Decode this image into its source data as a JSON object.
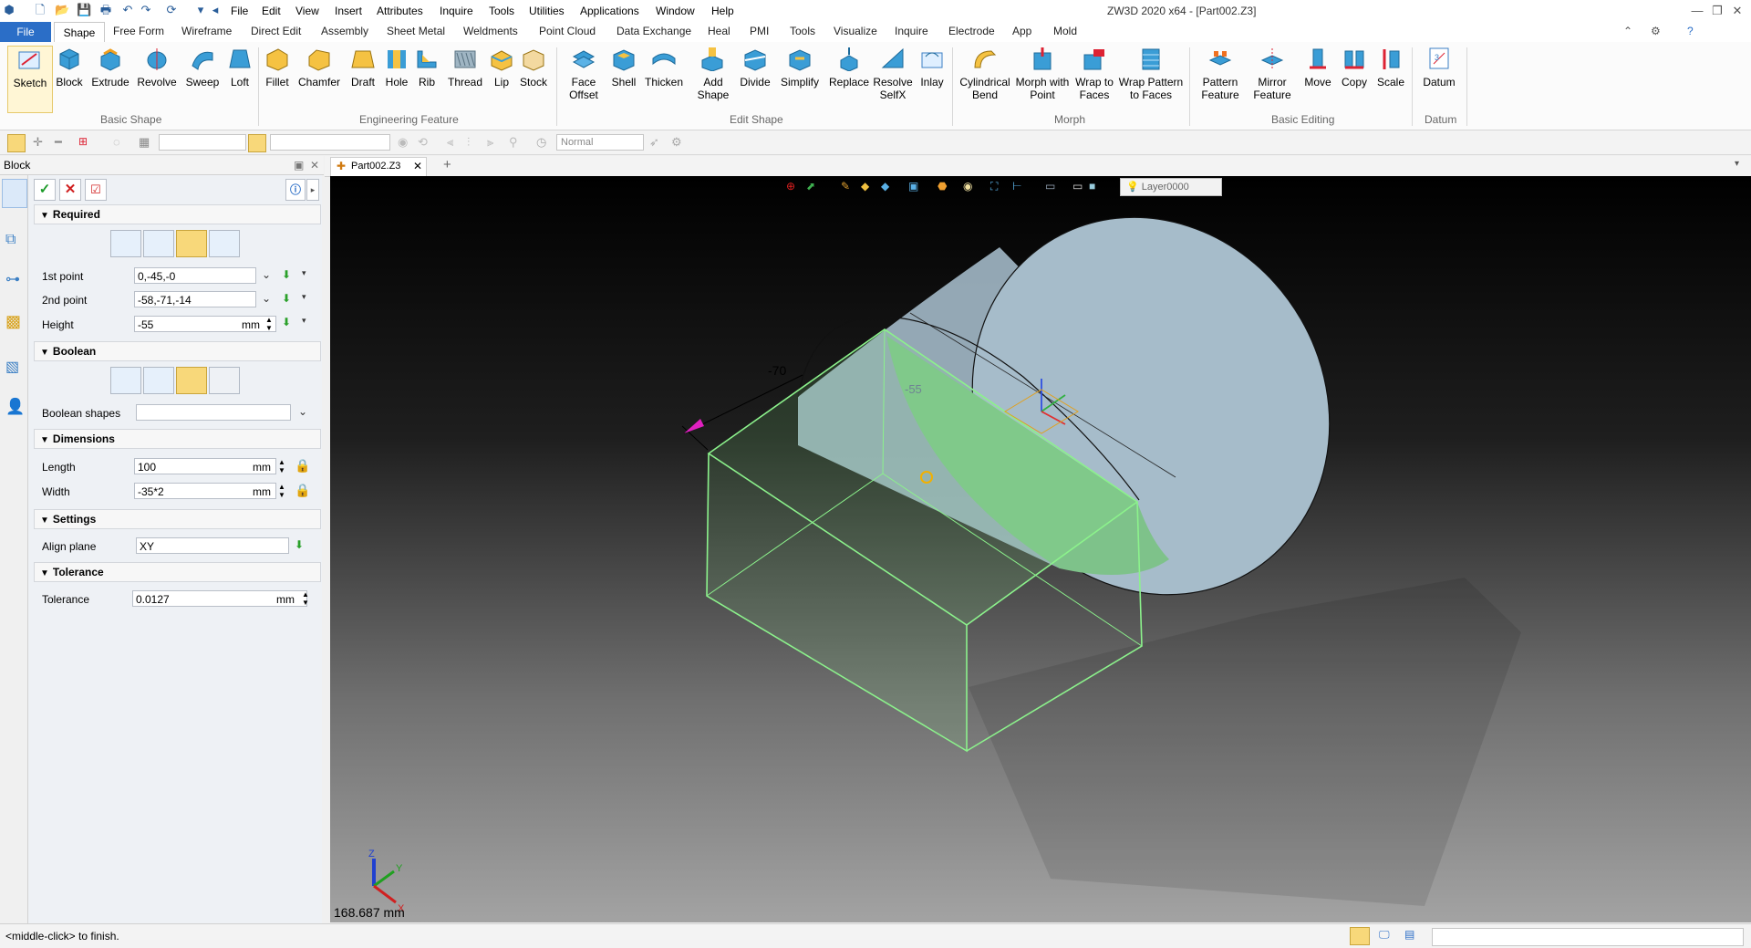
{
  "window": {
    "title": "ZW3D 2020 x64 - [Part002.Z3]",
    "menus": [
      "File",
      "Edit",
      "View",
      "Insert",
      "Attributes",
      "Inquire",
      "Tools",
      "Utilities",
      "Applications",
      "Window",
      "Help"
    ]
  },
  "ribbon": {
    "file_tab": "File",
    "tabs": [
      "Shape",
      "Free Form",
      "Wireframe",
      "Direct Edit",
      "Assembly",
      "Sheet Metal",
      "Weldments",
      "Point Cloud",
      "Data Exchange",
      "Heal",
      "PMI",
      "Tools",
      "Visualize",
      "Inquire",
      "Electrode",
      "App",
      "Mold"
    ],
    "active_tab": "Shape",
    "groups": [
      {
        "label": "Basic Shape",
        "buttons": [
          "Sketch",
          "Block",
          "Extrude",
          "Revolve",
          "Sweep",
          "Loft"
        ]
      },
      {
        "label": "Engineering Feature",
        "buttons": [
          "Fillet",
          "Chamfer",
          "Draft",
          "Hole",
          "Rib",
          "Thread",
          "Lip",
          "Stock"
        ]
      },
      {
        "label": "Edit Shape",
        "buttons": [
          "Face Offset",
          "Shell",
          "Thicken",
          "Add Shape",
          "Divide",
          "Simplify",
          "Replace",
          "Resolve SelfX",
          "Inlay"
        ]
      },
      {
        "label": "Morph",
        "buttons": [
          "Cylindrical Bend",
          "Morph with Point",
          "Wrap to Faces",
          "Wrap Pattern to Faces"
        ]
      },
      {
        "label": "Basic Editing",
        "buttons": [
          "Pattern Feature",
          "Mirror Feature",
          "Move",
          "Copy",
          "Scale"
        ]
      },
      {
        "label": "Datum",
        "buttons": [
          "Datum"
        ]
      }
    ]
  },
  "toolbar2": {
    "style_combo": "Normal"
  },
  "panel": {
    "title": "Block",
    "sections": {
      "required": "Required",
      "boolean": "Boolean",
      "dimensions": "Dimensions",
      "settings": "Settings",
      "tolerance": "Tolerance"
    },
    "fields": {
      "first_point": {
        "label": "1st point",
        "value": "0,-45,-0"
      },
      "second_point": {
        "label": "2nd point",
        "value": "-58,-71,-14"
      },
      "height": {
        "label": "Height",
        "value": "-55",
        "unit": "mm"
      },
      "boolean_shapes": {
        "label": "Boolean shapes",
        "value": ""
      },
      "length": {
        "label": "Length",
        "value": "100",
        "unit": "mm"
      },
      "width": {
        "label": "Width",
        "value": "-35*2",
        "unit": "mm"
      },
      "align_plane": {
        "label": "Align plane",
        "value": "XY"
      },
      "tolerance": {
        "label": "Tolerance",
        "value": "0.0127",
        "unit": "mm"
      }
    }
  },
  "document": {
    "tab": "Part002.Z3",
    "add": "+"
  },
  "viewport": {
    "layer": "Layer0000",
    "dim_a": "-70",
    "dim_b": "-55",
    "measurement": "168.687 mm",
    "axis_labels": {
      "x": "X",
      "y": "Y",
      "z": "Z"
    }
  },
  "status": {
    "hint": "<middle-click> to finish."
  },
  "colors": {
    "accent": "#2b6ec7",
    "wire": "#8cf28c",
    "cylinder": "#9fb5c3",
    "cut_face": "#7ec28a"
  }
}
